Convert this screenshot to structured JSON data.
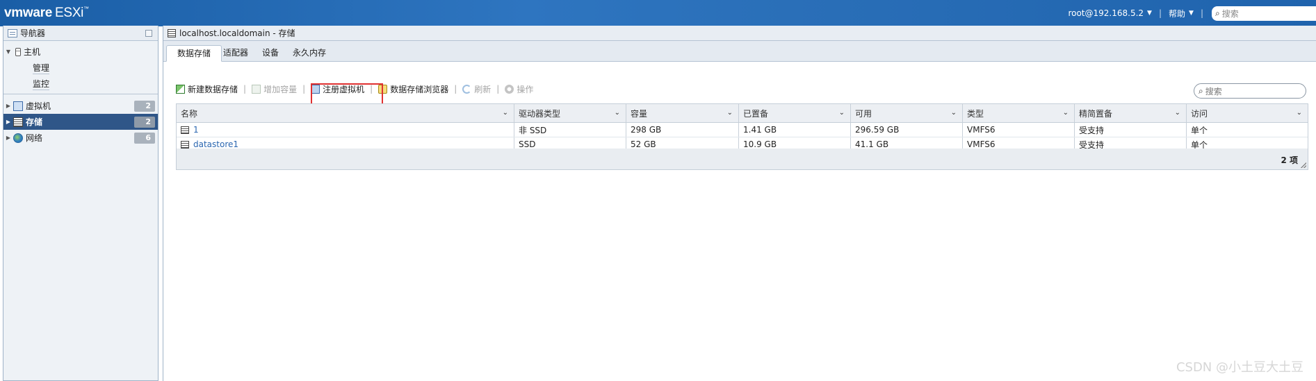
{
  "topbar": {
    "brand_vm": "vmware",
    "brand_esxi": "ESXi",
    "brand_tm": "™",
    "user": "root@192.168.5.2",
    "help": "帮助",
    "search_placeholder": "搜索"
  },
  "navigator": {
    "title": "导航器",
    "host": {
      "label": "主机",
      "children": [
        "管理",
        "监控"
      ]
    },
    "items": [
      {
        "label": "虚拟机",
        "count": "2",
        "icon": "vm-icon"
      },
      {
        "label": "存储",
        "count": "2",
        "icon": "storage-icon",
        "selected": true
      },
      {
        "label": "网络",
        "count": "6",
        "icon": "network-icon"
      }
    ]
  },
  "panel": {
    "title": "localhost.localdomain - 存储",
    "tabs": [
      "数据存储",
      "适配器",
      "设备",
      "永久内存"
    ],
    "active_tab": "数据存储",
    "toolbar": {
      "new_datastore": "新建数据存储",
      "increase_capacity": "增加容量",
      "register_vm": "注册虚拟机",
      "datastore_browser": "数据存储浏览器",
      "refresh": "刷新",
      "actions": "操作"
    },
    "search_placeholder": "搜索"
  },
  "grid": {
    "columns": [
      "名称",
      "驱动器类型",
      "容量",
      "已置备",
      "可用",
      "类型",
      "精简置备",
      "访问"
    ],
    "rows": [
      [
        "1",
        "非 SSD",
        "298 GB",
        "1.41 GB",
        "296.59 GB",
        "VMFS6",
        "受支持",
        "单个"
      ],
      [
        "datastore1",
        "SSD",
        "52 GB",
        "10.9 GB",
        "41.1 GB",
        "VMFS6",
        "受支持",
        "单个"
      ]
    ],
    "footer_count": "2 项"
  },
  "watermark": "CSDN @小土豆大土豆",
  "colors": {
    "topbar": "#2a6fb8",
    "selected_nav": "#2f5688",
    "link": "#2a66b0",
    "highlight": "#e03030"
  }
}
